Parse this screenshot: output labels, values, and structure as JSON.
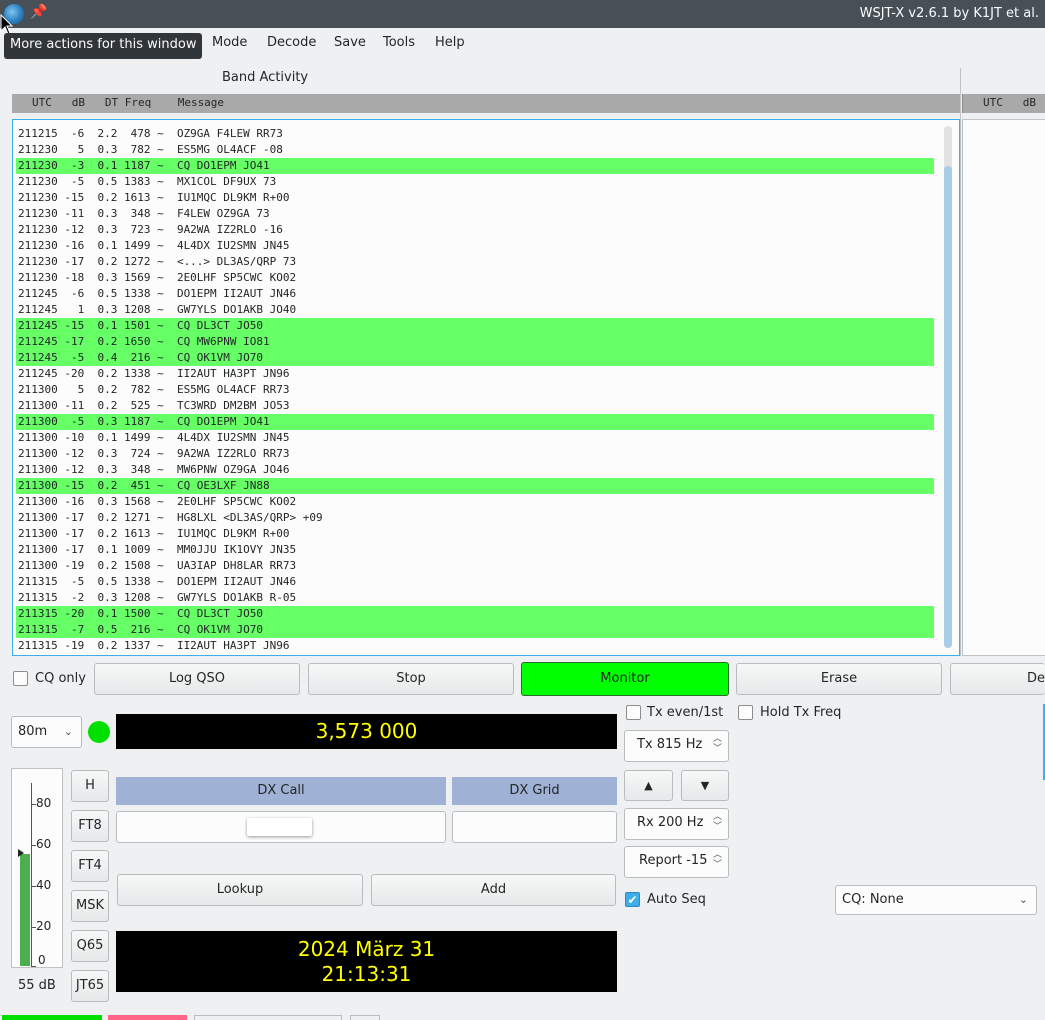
{
  "window": {
    "title": "WSJT-X v2.6.1 by K1JT et al.",
    "tooltip": "More actions for this window"
  },
  "menu": [
    "Mode",
    "Decode",
    "Save",
    "Tools",
    "Help"
  ],
  "band_activity": {
    "label": "Band Activity",
    "header": "UTC   dB   DT Freq    Message",
    "right_header": "UTC   dB",
    "rows": [
      {
        "text": "211215  -6  2.2  478 ~  OZ9GA F4LEW RR73",
        "cq": false
      },
      {
        "text": "211230   5  0.3  782 ~  ES5MG OL4ACF -08",
        "cq": false
      },
      {
        "text": "211230  -3  0.1 1187 ~  CQ DO1EPM JO41",
        "cq": true
      },
      {
        "text": "211230  -5  0.5 1383 ~  MX1COL DF9UX 73",
        "cq": false
      },
      {
        "text": "211230 -15  0.2 1613 ~  IU1MQC DL9KM R+00",
        "cq": false
      },
      {
        "text": "211230 -11  0.3  348 ~  F4LEW OZ9GA 73",
        "cq": false
      },
      {
        "text": "211230 -12  0.3  723 ~  9A2WA IZ2RLO -16",
        "cq": false
      },
      {
        "text": "211230 -16  0.1 1499 ~  4L4DX IU2SMN JN45",
        "cq": false
      },
      {
        "text": "211230 -17  0.2 1272 ~  <...> DL3AS/QRP 73",
        "cq": false
      },
      {
        "text": "211230 -18  0.3 1569 ~  2E0LHF SP5CWC KO02",
        "cq": false
      },
      {
        "text": "211245  -6  0.5 1338 ~  DO1EPM II2AUT JN46",
        "cq": false
      },
      {
        "text": "211245   1  0.3 1208 ~  GW7YLS DO1AKB JO40",
        "cq": false
      },
      {
        "text": "211245 -15  0.1 1501 ~  CQ DL3CT JO50",
        "cq": true
      },
      {
        "text": "211245 -17  0.2 1650 ~  CQ MW6PNW IO81",
        "cq": true
      },
      {
        "text": "211245  -5  0.4  216 ~  CQ OK1VM JO70",
        "cq": true
      },
      {
        "text": "211245 -20  0.2 1338 ~  II2AUT HA3PT JN96",
        "cq": false
      },
      {
        "text": "211300   5  0.2  782 ~  ES5MG OL4ACF RR73",
        "cq": false
      },
      {
        "text": "211300 -11  0.2  525 ~  TC3WRD DM2BM JO53",
        "cq": false
      },
      {
        "text": "211300  -5  0.3 1187 ~  CQ DO1EPM JO41",
        "cq": true
      },
      {
        "text": "211300 -10  0.1 1499 ~  4L4DX IU2SMN JN45",
        "cq": false
      },
      {
        "text": "211300 -12  0.3  724 ~  9A2WA IZ2RLO RR73",
        "cq": false
      },
      {
        "text": "211300 -12  0.3  348 ~  MW6PNW OZ9GA JO46",
        "cq": false
      },
      {
        "text": "211300 -15  0.2  451 ~  CQ OE3LXF JN88",
        "cq": true
      },
      {
        "text": "211300 -16  0.3 1568 ~  2E0LHF SP5CWC KO02",
        "cq": false
      },
      {
        "text": "211300 -17  0.2 1271 ~  HG8LXL <DL3AS/QRP> +09",
        "cq": false
      },
      {
        "text": "211300 -17  0.2 1613 ~  IU1MQC DL9KM R+00",
        "cq": false
      },
      {
        "text": "211300 -17  0.1 1009 ~  MM0JJU IK1OVY JN35",
        "cq": false
      },
      {
        "text": "211300 -19  0.2 1508 ~  UA3IAP DH8LAR RR73",
        "cq": false
      },
      {
        "text": "211315  -5  0.5 1338 ~  DO1EPM II2AUT JN46",
        "cq": false
      },
      {
        "text": "211315  -2  0.3 1208 ~  GW7YLS DO1AKB R-05",
        "cq": false
      },
      {
        "text": "211315 -20  0.1 1500 ~  CQ DL3CT JO50",
        "cq": true
      },
      {
        "text": "211315  -7  0.5  216 ~  CQ OK1VM JO70",
        "cq": true
      },
      {
        "text": "211315 -19  0.2 1337 ~  II2AUT HA3PT JN96",
        "cq": false
      }
    ]
  },
  "controls": {
    "cq_only": "CQ only",
    "log_qso": "Log QSO",
    "stop": "Stop",
    "monitor": "Monitor",
    "erase": "Erase",
    "decode_partial": "De",
    "band": "80m",
    "frequency": "3,573 000",
    "tx_even": "Tx even/1st",
    "hold_tx_freq": "Hold Tx Freq",
    "tx_freq": "Tx  815  Hz",
    "rx_freq": "Rx  200  Hz",
    "report": "Report -15",
    "up_arrow": "▲",
    "down_arrow": "▼",
    "auto_seq": "Auto Seq",
    "cq_select": "CQ: None",
    "dx_call_label": "DX Call",
    "dx_grid_label": "DX Grid",
    "lookup": "Lookup",
    "add": "Add",
    "date": "2024 März 31",
    "time": "21:13:31"
  },
  "mode_buttons": [
    "H",
    "FT8",
    "FT4",
    "MSK",
    "Q65",
    "JT65"
  ],
  "meter": {
    "ticks": [
      "80",
      "60",
      "40",
      "20",
      "0"
    ],
    "level_label": "55 dB",
    "level_db": 55
  },
  "colors": {
    "cq_highlight": "#66ff66",
    "monitor_on": "#00ff00",
    "lcd_text": "#ffff00",
    "meter_bar": "#4cae4c"
  }
}
